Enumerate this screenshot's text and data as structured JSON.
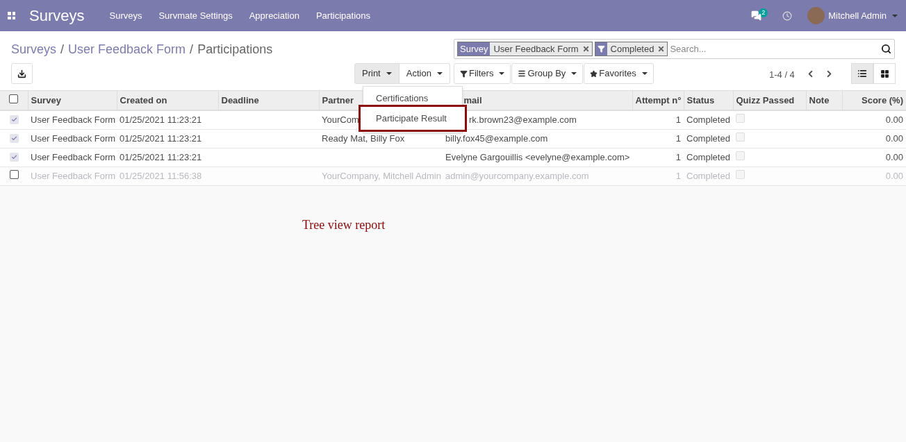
{
  "navbar": {
    "app_title": "Surveys",
    "menu": [
      "Surveys",
      "Survmate Settings",
      "Appreciation",
      "Participations"
    ],
    "message_count": "2",
    "user": "Mitchell Admin"
  },
  "breadcrumb": [
    {
      "label": "Surveys",
      "link": true
    },
    {
      "label": "User Feedback Form",
      "link": true
    },
    {
      "label": "Participations",
      "link": false
    }
  ],
  "breadcrumb_separators": [
    "/",
    "/"
  ],
  "search": {
    "facets": [
      {
        "kind": "field",
        "label": "Survey",
        "value": "User Feedback Form"
      },
      {
        "kind": "filter",
        "value": "Completed"
      }
    ],
    "placeholder": "Search..."
  },
  "buttons": {
    "print": "Print",
    "action": "Action",
    "filters": "Filters",
    "group_by": "Group By",
    "favorites": "Favorites"
  },
  "pager": "1-4 / 4",
  "views": [
    {
      "kind": "list",
      "selected": true
    },
    {
      "kind": "kanban",
      "selected": false
    }
  ],
  "print_menu": [
    {
      "label": "Certifications",
      "highlighted": false
    },
    {
      "label": "Participate Result",
      "highlighted": true
    }
  ],
  "table": {
    "all_selected": false,
    "columns": [
      "Survey",
      "Created on",
      "Deadline",
      "Partner",
      "mail",
      "Attempt n°",
      "Status",
      "Quizz Passed",
      "Note",
      "Score (%)"
    ],
    "rows": [
      {
        "selected": true,
        "muted": false,
        "survey": "User Feedback Form",
        "created_on": "01/25/2021 11:23:21",
        "partner": "YourCom",
        "email": "rk.brown23@example.com",
        "attempt": "1",
        "status": "Completed",
        "quizz_passed": false,
        "score": "0.00"
      },
      {
        "selected": true,
        "muted": false,
        "survey": "User Feedback Form",
        "created_on": "01/25/2021 11:23:21",
        "partner": "Ready Mat, Billy Fox",
        "email": "billy.fox45@example.com",
        "attempt": "1",
        "status": "Completed",
        "quizz_passed": false,
        "score": "0.00"
      },
      {
        "selected": true,
        "muted": false,
        "survey": "User Feedback Form",
        "created_on": "01/25/2021 11:23:21",
        "partner": "",
        "email": "Evelyne Gargouillis <evelyne@example.com>",
        "attempt": "1",
        "status": "Completed",
        "quizz_passed": false,
        "score": "0.00"
      },
      {
        "selected": false,
        "muted": true,
        "survey": "User Feedback Form",
        "created_on": "01/25/2021 11:56:38",
        "partner": "YourCompany, Mitchell Admin",
        "email": "admin@yourcompany.example.com",
        "attempt": "1",
        "status": "Completed",
        "quizz_passed": false,
        "score": "0.00"
      }
    ]
  },
  "annotation": "Tree view report"
}
